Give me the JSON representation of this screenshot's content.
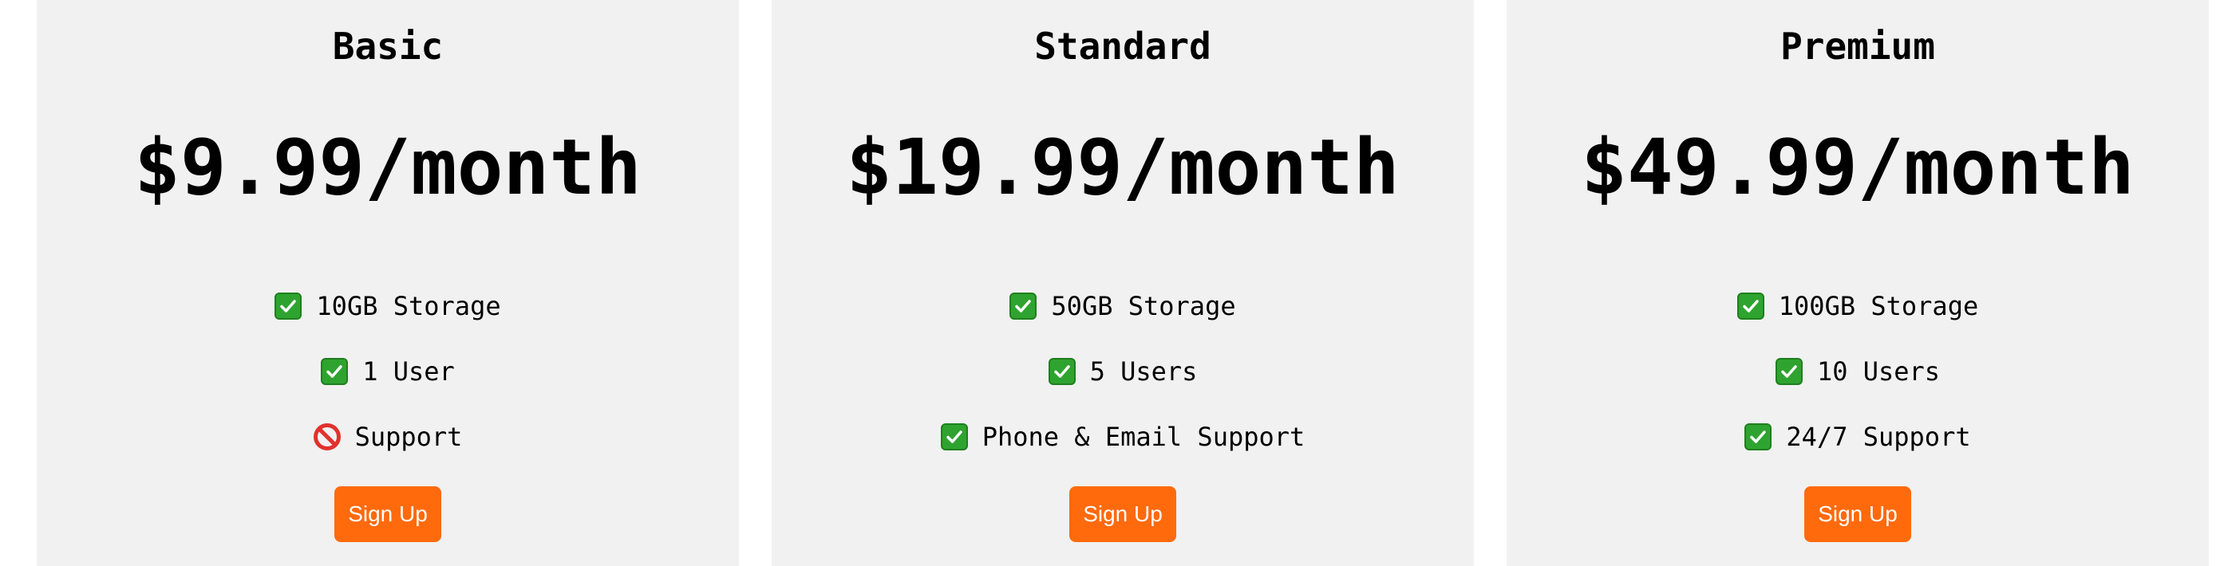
{
  "plans": [
    {
      "name": "Basic",
      "price": "$9.99/month",
      "features": [
        {
          "icon": "check-icon",
          "text": "10GB Storage"
        },
        {
          "icon": "check-icon",
          "text": "1 User"
        },
        {
          "icon": "prohibited-icon",
          "text": "Support"
        }
      ],
      "button_label": "Sign Up"
    },
    {
      "name": "Standard",
      "price": "$19.99/month",
      "features": [
        {
          "icon": "check-icon",
          "text": "50GB Storage"
        },
        {
          "icon": "check-icon",
          "text": "5 Users"
        },
        {
          "icon": "check-icon",
          "text": "Phone & Email Support"
        }
      ],
      "button_label": "Sign Up"
    },
    {
      "name": "Premium",
      "price": "$49.99/month",
      "features": [
        {
          "icon": "check-icon",
          "text": "100GB Storage"
        },
        {
          "icon": "check-icon",
          "text": "10 Users"
        },
        {
          "icon": "check-icon",
          "text": "24/7 Support"
        }
      ],
      "button_label": "Sign Up"
    }
  ],
  "colors": {
    "card_background": "#f1f1f1",
    "button_background": "#ff6a0d",
    "button_text": "#ffffff",
    "check_icon": "#2fa32f",
    "prohibited_icon": "#e0322d"
  }
}
